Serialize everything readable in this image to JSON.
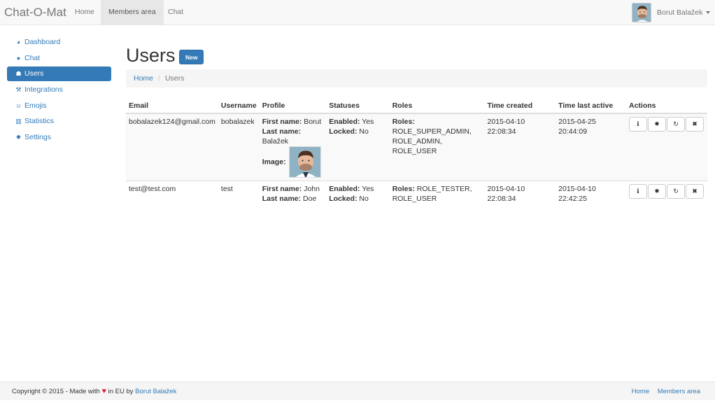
{
  "navbar": {
    "brand": "Chat-O-Mat",
    "items": [
      {
        "label": "Home"
      },
      {
        "label": "Members area",
        "active": true
      },
      {
        "label": "Chat"
      }
    ],
    "user_name": "Borut Balažek"
  },
  "sidebar": {
    "items": [
      {
        "label": "Dashboard",
        "icon": "dashboard-icon"
      },
      {
        "label": "Chat",
        "icon": "comment-icon"
      },
      {
        "label": "Users",
        "icon": "users-icon",
        "active": true
      },
      {
        "label": "Integrations",
        "icon": "wrench-icon"
      },
      {
        "label": "Emojis",
        "icon": "smile-icon"
      },
      {
        "label": "Statistics",
        "icon": "bar-chart-icon"
      },
      {
        "label": "Settings",
        "icon": "gear-icon"
      }
    ]
  },
  "page": {
    "title": "Users",
    "new_button": "New",
    "breadcrumb": {
      "home": "Home",
      "current": "Users"
    }
  },
  "table": {
    "headers": [
      "Email",
      "Username",
      "Profile",
      "Statuses",
      "Roles",
      "Time created",
      "Time last active",
      "Actions"
    ],
    "rows": [
      {
        "email": "bobalazek124@gmail.com",
        "username": "bobalazek",
        "first_name_label": "First name:",
        "first_name": "Borut",
        "last_name_label": "Last name:",
        "last_name": "Balažek",
        "image_label": "Image:",
        "enabled_label": "Enabled:",
        "enabled": "Yes",
        "locked_label": "Locked:",
        "locked": "No",
        "roles_label": "Roles:",
        "roles": "ROLE_SUPER_ADMIN, ROLE_ADMIN, ROLE_USER",
        "time_created": "2015-04-10 22:08:34",
        "time_last_active": "2015-04-25 20:44:09"
      },
      {
        "email": "test@test.com",
        "username": "test",
        "first_name_label": "First name:",
        "first_name": "John",
        "last_name_label": "Last name:",
        "last_name": "Doe",
        "enabled_label": "Enabled:",
        "enabled": "Yes",
        "locked_label": "Locked:",
        "locked": "No",
        "roles_label": "Roles:",
        "roles": "ROLE_TESTER, ROLE_USER",
        "time_created": "2015-04-10 22:08:34",
        "time_last_active": "2015-04-10 22:42:25"
      }
    ],
    "action_icons": [
      "info-icon",
      "gear-icon",
      "refresh-icon",
      "close-icon"
    ]
  },
  "footer": {
    "copyright": "Copyright © 2015 - Made with",
    "in_eu_by": "in EU by",
    "author": "Borut Balažek",
    "links": [
      "Home",
      "Members area"
    ]
  },
  "colors": {
    "primary": "#337ab7",
    "heart": "#e0243b"
  }
}
